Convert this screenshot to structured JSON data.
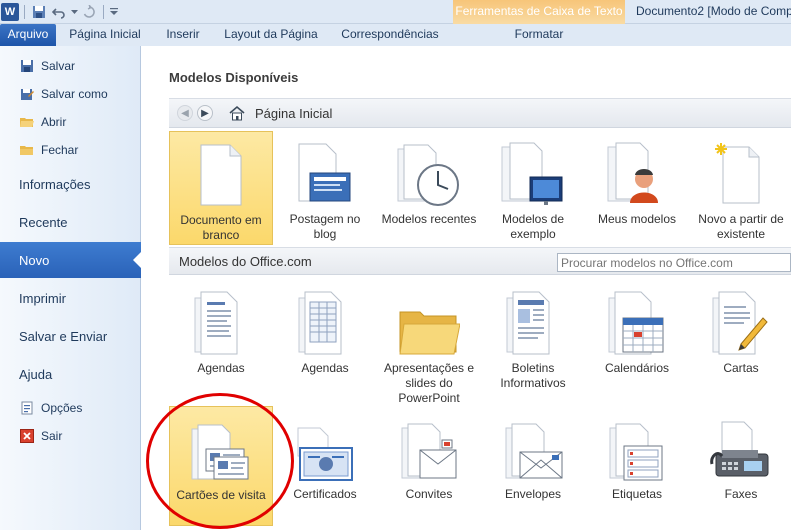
{
  "titlebar": {
    "word_icon_letter": "W",
    "tools_context": "Ferramentas de Caixa de Texto",
    "document_title": "Documento2 [Modo de Comp"
  },
  "ribbon_tabs": {
    "file": "Arquivo",
    "home": "Página Inicial",
    "insert": "Inserir",
    "page_layout": "Layout da Página",
    "mailings": "Correspondências",
    "format": "Formatar"
  },
  "backstage_nav": {
    "save": "Salvar",
    "save_as": "Salvar como",
    "open": "Abrir",
    "close": "Fechar",
    "info": "Informações",
    "recent": "Recente",
    "new": "Novo",
    "print": "Imprimir",
    "save_send": "Salvar e Enviar",
    "help": "Ajuda",
    "options": "Opções",
    "exit": "Sair"
  },
  "available_templates": {
    "title": "Modelos Disponíveis",
    "breadcrumb": "Página Inicial",
    "tiles": [
      {
        "label": "Documento em\nbranco",
        "icon": "blank-document-icon"
      },
      {
        "label": "Postagem no\nblog",
        "icon": "blog-post-icon"
      },
      {
        "label": "Modelos recentes",
        "icon": "recent-templates-icon"
      },
      {
        "label": "Modelos de\nexemplo",
        "icon": "sample-templates-icon"
      },
      {
        "label": "Meus modelos",
        "icon": "my-templates-icon"
      },
      {
        "label": "Novo a partir de\nexistente",
        "icon": "new-from-existing-icon"
      }
    ]
  },
  "office_templates": {
    "title": "Modelos do Office.com",
    "search_placeholder": "Procurar modelos no Office.com",
    "row1": [
      {
        "label": "Agendas",
        "icon": "agenda-icon"
      },
      {
        "label": "Agendas",
        "icon": "agenda-table-icon"
      },
      {
        "label": "Apresentações e\nslides do\nPowerPoint",
        "icon": "folder-icon"
      },
      {
        "label": "Boletins\nInformativos",
        "icon": "newsletter-icon"
      },
      {
        "label": "Calendários",
        "icon": "calendar-icon"
      },
      {
        "label": "Cartas",
        "icon": "letter-icon"
      }
    ],
    "row2": [
      {
        "label": "Cartões de visita",
        "icon": "business-card-icon"
      },
      {
        "label": "Certificados",
        "icon": "certificate-icon"
      },
      {
        "label": "Convites",
        "icon": "invitation-icon"
      },
      {
        "label": "Envelopes",
        "icon": "envelope-icon"
      },
      {
        "label": "Etiquetas",
        "icon": "labels-icon"
      },
      {
        "label": "Faxes",
        "icon": "fax-icon"
      }
    ]
  },
  "colors": {
    "file_tab": "#2a62b8",
    "selected_tile": "#fbd86b",
    "annotation": "#e00000",
    "context_tab": "#f7c579"
  }
}
